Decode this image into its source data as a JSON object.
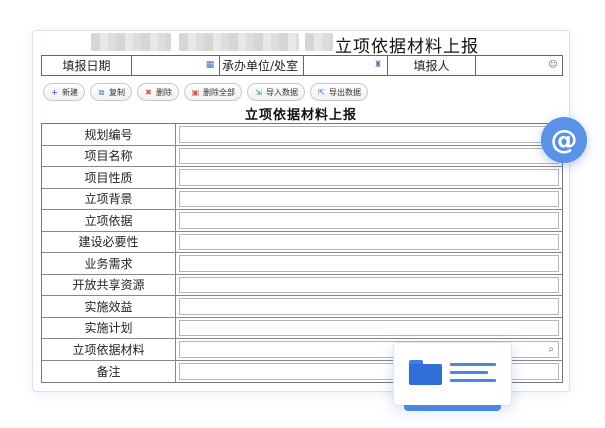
{
  "header": {
    "title": "立项依据材料上报"
  },
  "info_bar": {
    "fill_date_label": "填报日期",
    "dept_label": "承办单位/处室",
    "reporter_label": "填报人"
  },
  "toolbar": {
    "buttons": [
      {
        "icon": "plus-icon",
        "label": "新建"
      },
      {
        "icon": "copy-icon",
        "label": "复制"
      },
      {
        "icon": "trash-icon",
        "label": "删除"
      },
      {
        "icon": "trash-all-icon",
        "label": "删除全部"
      },
      {
        "icon": "import-icon",
        "label": "导入数据"
      },
      {
        "icon": "export-icon",
        "label": "导出数据"
      }
    ]
  },
  "form": {
    "title": "立项依据材料上报",
    "rows": [
      {
        "label": "规划编号"
      },
      {
        "label": "项目名称"
      },
      {
        "label": "项目性质"
      },
      {
        "label": "立项背景"
      },
      {
        "label": "立项依据"
      },
      {
        "label": "建设必要性"
      },
      {
        "label": "业务需求"
      },
      {
        "label": "开放共享资源"
      },
      {
        "label": "实施效益"
      },
      {
        "label": "实施计划"
      },
      {
        "label": "立项依据材料",
        "attachment": true
      },
      {
        "label": "备注"
      }
    ]
  },
  "colors": {
    "accent": "#5a93e6",
    "folder": "#2f6fd8",
    "border": "#777777"
  }
}
